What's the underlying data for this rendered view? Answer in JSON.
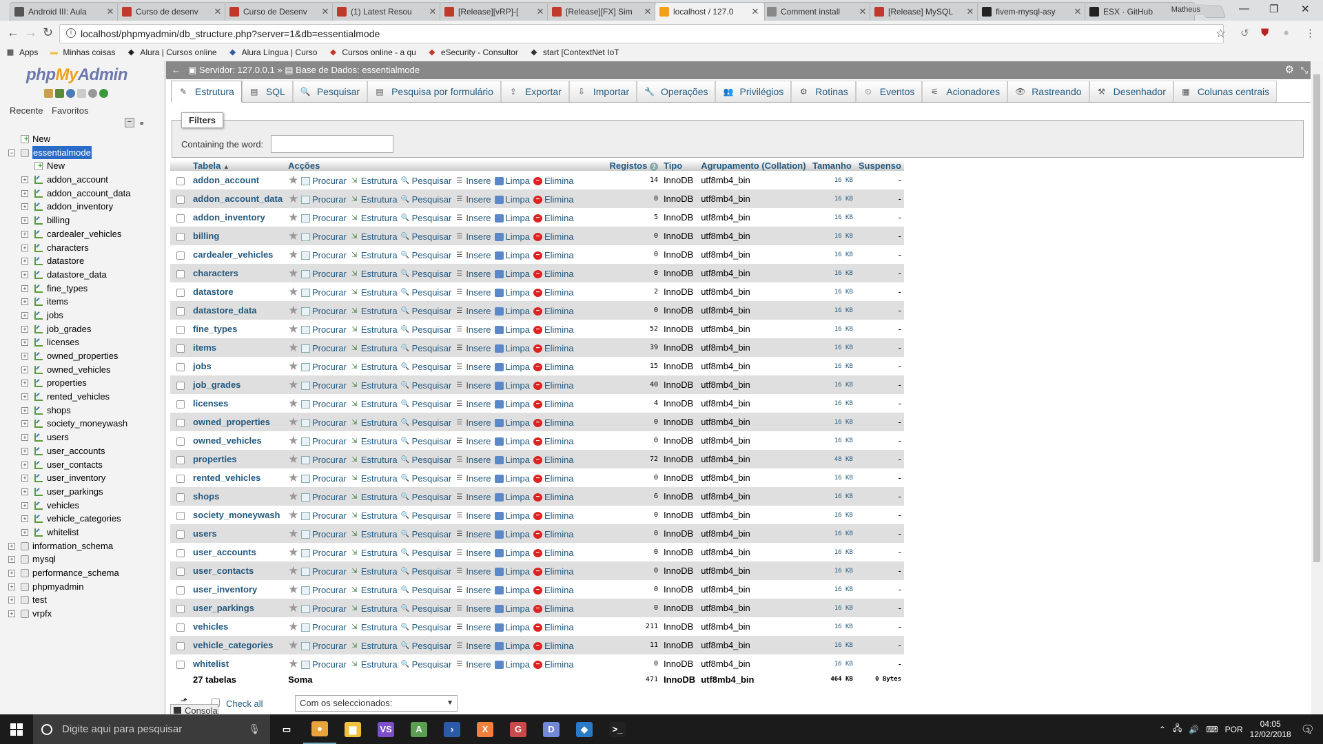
{
  "browser": {
    "tabs": [
      {
        "title": "Android III: Aula",
        "color": "#555"
      },
      {
        "title": "Curso de desenv",
        "color": "#c0392b"
      },
      {
        "title": "Curso de Desenv",
        "color": "#c0392b"
      },
      {
        "title": "(1) Latest Resou",
        "color": "#c0392b"
      },
      {
        "title": "[Release][vRP]-[",
        "color": "#c0392b"
      },
      {
        "title": "[Release][FX] Sim",
        "color": "#c0392b"
      },
      {
        "title": "localhost / 127.0",
        "color": "#f29f1c"
      },
      {
        "title": "Comment install",
        "color": "#888"
      },
      {
        "title": "[Release] MySQL",
        "color": "#c0392b"
      },
      {
        "title": "fivem-mysql-asy",
        "color": "#222"
      },
      {
        "title": "ESX · GitHub",
        "color": "#222"
      }
    ],
    "active_tab": 6,
    "profile": "Matheus",
    "url": "localhost/phpmyadmin/db_structure.php?server=1&db=essentialmode",
    "bookmarks": [
      {
        "label": "Apps",
        "color": "#555"
      },
      {
        "label": "Minhas coisas",
        "color": "#f0c040"
      },
      {
        "label": "Alura | Cursos online",
        "color": "#222"
      },
      {
        "label": "Alura Língua | Curso",
        "color": "#3a5aa0"
      },
      {
        "label": "Cursos online - a qu",
        "color": "#c0392b"
      },
      {
        "label": "eSecurity - Consultor",
        "color": "#c0392b"
      },
      {
        "label": "start [ContextNet IoT",
        "color": "#333"
      }
    ]
  },
  "pma": {
    "logo_php": "php",
    "logo_my": "My",
    "logo_admin": "Admin",
    "recent": "Recente",
    "favorites": "Favoritos",
    "tree_new": "New",
    "selected_db": "essentialmode",
    "db_new": "New",
    "tree_tables": [
      "addon_account",
      "addon_account_data",
      "addon_inventory",
      "billing",
      "cardealer_vehicles",
      "characters",
      "datastore",
      "datastore_data",
      "fine_types",
      "items",
      "jobs",
      "job_grades",
      "licenses",
      "owned_properties",
      "owned_vehicles",
      "properties",
      "rented_vehicles",
      "shops",
      "society_moneywash",
      "users",
      "user_accounts",
      "user_contacts",
      "user_inventory",
      "user_parkings",
      "vehicles",
      "vehicle_categories",
      "whitelist"
    ],
    "other_dbs": [
      "information_schema",
      "mysql",
      "performance_schema",
      "phpmyadmin",
      "test",
      "vrpfx"
    ],
    "breadcrumb_server": "Servidor: 127.0.0.1",
    "breadcrumb_db": "Base de Dados: essentialmode",
    "tabs": [
      "Estrutura",
      "SQL",
      "Pesquisar",
      "Pesquisa por formulário",
      "Exportar",
      "Importar",
      "Operações",
      "Privilégios",
      "Rotinas",
      "Eventos",
      "Acionadores",
      "Rastreando",
      "Desenhador",
      "Colunas centrais"
    ],
    "filters_title": "Filters",
    "filters_label": "Containing the word:",
    "headers": {
      "table": "Tabela",
      "actions": "Acções",
      "rows": "Registos",
      "type": "Tipo",
      "collation": "Agrupamento (Collation)",
      "size": "Tamanho",
      "overhead": "Suspenso"
    },
    "action_labels": {
      "browse": "Procurar",
      "structure": "Estrutura",
      "search": "Pesquisar",
      "insert": "Insere",
      "empty": "Limpa",
      "drop": "Elimina"
    },
    "rows": [
      {
        "name": "addon_account",
        "rows": "14",
        "type": "InnoDB",
        "collation": "utf8mb4_bin",
        "size": "16 KB",
        "overhead": "-"
      },
      {
        "name": "addon_account_data",
        "rows": "0",
        "type": "InnoDB",
        "collation": "utf8mb4_bin",
        "size": "16 KB",
        "overhead": "-"
      },
      {
        "name": "addon_inventory",
        "rows": "5",
        "type": "InnoDB",
        "collation": "utf8mb4_bin",
        "size": "16 KB",
        "overhead": "-"
      },
      {
        "name": "billing",
        "rows": "0",
        "type": "InnoDB",
        "collation": "utf8mb4_bin",
        "size": "16 KB",
        "overhead": "-"
      },
      {
        "name": "cardealer_vehicles",
        "rows": "0",
        "type": "InnoDB",
        "collation": "utf8mb4_bin",
        "size": "16 KB",
        "overhead": "-"
      },
      {
        "name": "characters",
        "rows": "0",
        "type": "InnoDB",
        "collation": "utf8mb4_bin",
        "size": "16 KB",
        "overhead": "-"
      },
      {
        "name": "datastore",
        "rows": "2",
        "type": "InnoDB",
        "collation": "utf8mb4_bin",
        "size": "16 KB",
        "overhead": "-"
      },
      {
        "name": "datastore_data",
        "rows": "0",
        "type": "InnoDB",
        "collation": "utf8mb4_bin",
        "size": "16 KB",
        "overhead": "-"
      },
      {
        "name": "fine_types",
        "rows": "52",
        "type": "InnoDB",
        "collation": "utf8mb4_bin",
        "size": "16 KB",
        "overhead": "-"
      },
      {
        "name": "items",
        "rows": "39",
        "type": "InnoDB",
        "collation": "utf8mb4_bin",
        "size": "16 KB",
        "overhead": "-"
      },
      {
        "name": "jobs",
        "rows": "15",
        "type": "InnoDB",
        "collation": "utf8mb4_bin",
        "size": "16 KB",
        "overhead": "-"
      },
      {
        "name": "job_grades",
        "rows": "40",
        "type": "InnoDB",
        "collation": "utf8mb4_bin",
        "size": "16 KB",
        "overhead": "-"
      },
      {
        "name": "licenses",
        "rows": "4",
        "type": "InnoDB",
        "collation": "utf8mb4_bin",
        "size": "16 KB",
        "overhead": "-"
      },
      {
        "name": "owned_properties",
        "rows": "0",
        "type": "InnoDB",
        "collation": "utf8mb4_bin",
        "size": "16 KB",
        "overhead": "-"
      },
      {
        "name": "owned_vehicles",
        "rows": "0",
        "type": "InnoDB",
        "collation": "utf8mb4_bin",
        "size": "16 KB",
        "overhead": "-"
      },
      {
        "name": "properties",
        "rows": "72",
        "type": "InnoDB",
        "collation": "utf8mb4_bin",
        "size": "48 KB",
        "overhead": "-"
      },
      {
        "name": "rented_vehicles",
        "rows": "0",
        "type": "InnoDB",
        "collation": "utf8mb4_bin",
        "size": "16 KB",
        "overhead": "-"
      },
      {
        "name": "shops",
        "rows": "6",
        "type": "InnoDB",
        "collation": "utf8mb4_bin",
        "size": "16 KB",
        "overhead": "-"
      },
      {
        "name": "society_moneywash",
        "rows": "0",
        "type": "InnoDB",
        "collation": "utf8mb4_bin",
        "size": "16 KB",
        "overhead": "-"
      },
      {
        "name": "users",
        "rows": "0",
        "type": "InnoDB",
        "collation": "utf8mb4_bin",
        "size": "16 KB",
        "overhead": "-"
      },
      {
        "name": "user_accounts",
        "rows": "0",
        "type": "InnoDB",
        "collation": "utf8mb4_bin",
        "size": "16 KB",
        "overhead": "-"
      },
      {
        "name": "user_contacts",
        "rows": "0",
        "type": "InnoDB",
        "collation": "utf8mb4_bin",
        "size": "16 KB",
        "overhead": "-"
      },
      {
        "name": "user_inventory",
        "rows": "0",
        "type": "InnoDB",
        "collation": "utf8mb4_bin",
        "size": "16 KB",
        "overhead": "-"
      },
      {
        "name": "user_parkings",
        "rows": "0",
        "type": "InnoDB",
        "collation": "utf8mb4_bin",
        "size": "16 KB",
        "overhead": "-"
      },
      {
        "name": "vehicles",
        "rows": "211",
        "type": "InnoDB",
        "collation": "utf8mb4_bin",
        "size": "16 KB",
        "overhead": "-"
      },
      {
        "name": "vehicle_categories",
        "rows": "11",
        "type": "InnoDB",
        "collation": "utf8mb4_bin",
        "size": "16 KB",
        "overhead": "-"
      },
      {
        "name": "whitelist",
        "rows": "0",
        "type": "InnoDB",
        "collation": "utf8mb4_bin",
        "size": "16 KB",
        "overhead": "-"
      }
    ],
    "footer": {
      "count": "27 tabelas",
      "sum": "Soma",
      "rows": "471",
      "type": "InnoDB",
      "collation": "utf8mb4_bin",
      "size": "464 KB",
      "overhead": "0 Bytes"
    },
    "check_all": "Check all",
    "with_selected": "Com os seleccionados:",
    "console": "Consola"
  },
  "taskbar": {
    "search_placeholder": "Digite aqui para pesquisar",
    "apps": [
      {
        "name": "task-view",
        "color": "#1b1b1b",
        "glyph": "▭"
      },
      {
        "name": "chrome",
        "color": "#e8a33d",
        "glyph": "●"
      },
      {
        "name": "explorer",
        "color": "#f0c040",
        "glyph": "▆"
      },
      {
        "name": "visual-studio",
        "color": "#7a4fc8",
        "glyph": "VS"
      },
      {
        "name": "android",
        "color": "#5aa050",
        "glyph": "A"
      },
      {
        "name": "powershell",
        "color": "#2a5aa8",
        "glyph": "›"
      },
      {
        "name": "xampp",
        "color": "#f0803a",
        "glyph": "X"
      },
      {
        "name": "game",
        "color": "#c84a4a",
        "glyph": "G"
      },
      {
        "name": "discord",
        "color": "#7289da",
        "glyph": "D"
      },
      {
        "name": "vscode",
        "color": "#2a7ac8",
        "glyph": "◆"
      },
      {
        "name": "terminal",
        "color": "#222",
        "glyph": ">_"
      }
    ],
    "lang": "POR",
    "time": "04:05",
    "date": "12/02/2018",
    "notifications": "3"
  }
}
